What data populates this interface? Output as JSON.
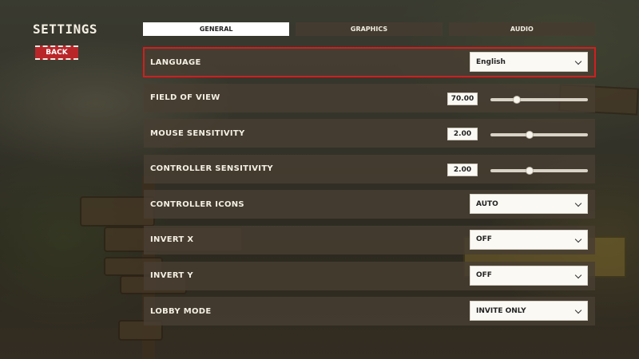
{
  "screen": {
    "title": "SETTINGS",
    "back_label": "BACK"
  },
  "tabs": [
    {
      "label": "GENERAL",
      "active": true
    },
    {
      "label": "GRAPHICS",
      "active": false
    },
    {
      "label": "AUDIO",
      "active": false
    }
  ],
  "settings": {
    "language": {
      "label": "LANGUAGE",
      "value": "English"
    },
    "field_of_view": {
      "label": "FIELD OF VIEW",
      "value": "70.00",
      "slider_fraction": 0.27
    },
    "mouse_sensitivity": {
      "label": "MOUSE SENSITIVITY",
      "value": "2.00",
      "slider_fraction": 0.4
    },
    "controller_sensitivity": {
      "label": "CONTROLLER SENSITIVITY",
      "value": "2.00",
      "slider_fraction": 0.4
    },
    "controller_icons": {
      "label": "CONTROLLER ICONS",
      "value": "AUTO"
    },
    "invert_x": {
      "label": "INVERT X",
      "value": "OFF"
    },
    "invert_y": {
      "label": "INVERT Y",
      "value": "OFF"
    },
    "lobby_mode": {
      "label": "LOBBY MODE",
      "value": "INVITE ONLY"
    }
  },
  "colors": {
    "accent_red": "#d01f1f",
    "back_button": "#b9262a",
    "row_bg": "#483e32",
    "active_tab": "#ffffff"
  }
}
